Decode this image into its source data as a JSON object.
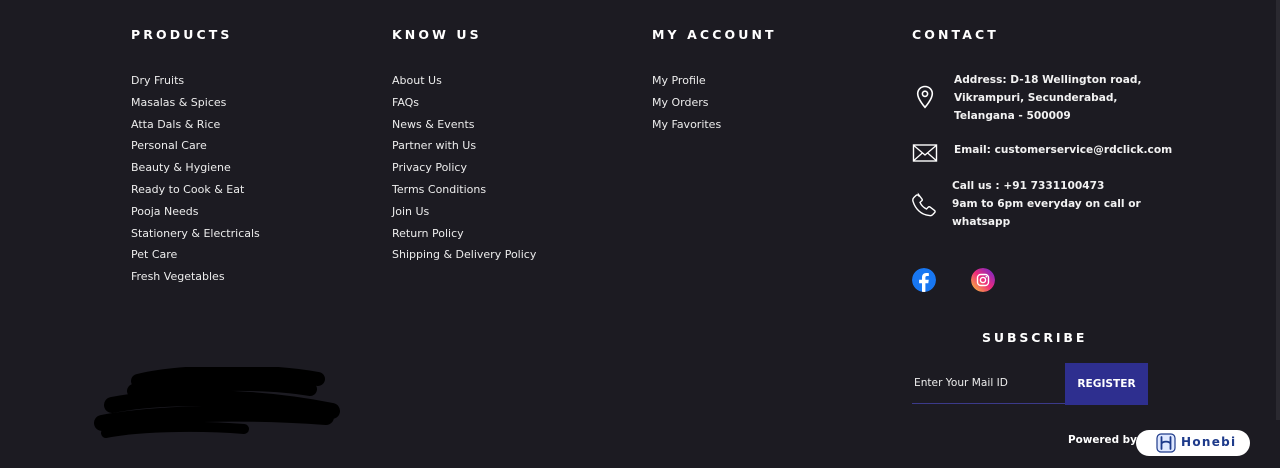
{
  "footer": {
    "products": {
      "title": "PRODUCTS",
      "links": [
        "Dry Fruits",
        "Masalas & Spices",
        "Atta Dals & Rice",
        "Personal Care",
        "Beauty & Hygiene",
        "Ready to Cook & Eat",
        "Pooja Needs",
        "Stationery & Electricals",
        "Pet Care",
        "Fresh Vegetables"
      ]
    },
    "know_us": {
      "title": "KNOW US",
      "links": [
        "About Us",
        "FAQs",
        "News & Events",
        "Partner with Us",
        "Privacy Policy",
        "Terms Conditions",
        "Join Us",
        "Return Policy",
        "Shipping & Delivery Policy"
      ]
    },
    "my_account": {
      "title": "MY ACCOUNT",
      "links": [
        "My Profile",
        "My Orders",
        "My Favorites"
      ]
    },
    "contact": {
      "title": "CONTACT",
      "address_lines": [
        "Address: D-18 Wellington road,",
        "Vikrampuri, Secunderabad,",
        "Telangana - 500009"
      ],
      "email": "Email: customerservice@rdclick.com",
      "phone_lines": [
        "Call us : +91 7331100473",
        "9am to 6pm everyday on call or",
        "whatsapp"
      ],
      "icons": {
        "address": "location-pin-icon",
        "email": "envelope-icon",
        "phone": "phone-icon"
      }
    },
    "social": {
      "facebook": "facebook-icon",
      "instagram": "instagram-icon",
      "colors": {
        "facebook": "#1877f2",
        "instagram_start": "#f9ce34",
        "instagram_mid": "#ee2a7b",
        "instagram_end": "#6228d7"
      }
    },
    "subscribe": {
      "title": "SUBSCRIBE",
      "input_placeholder": "Enter Your Mail ID",
      "button_label": "REGISTER"
    },
    "powered_by": {
      "label": "Powered by",
      "brand": "Honebi"
    },
    "colors": {
      "background": "#1c1b22",
      "accent": "#2e2f8f",
      "brand_text": "#1d3a8a"
    }
  }
}
